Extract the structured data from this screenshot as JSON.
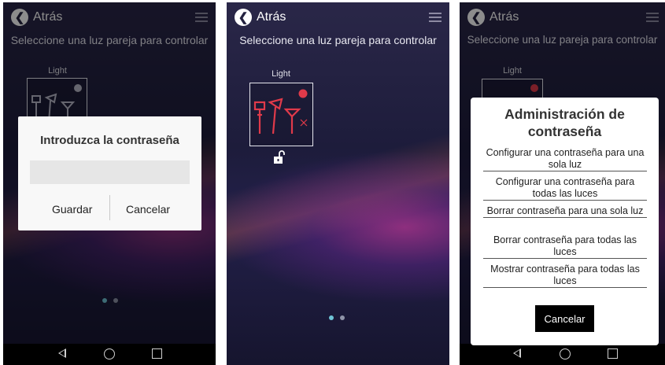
{
  "header": {
    "back_label": "Atrás",
    "subtitle": "Seleccione una luz pareja para controlar"
  },
  "device": {
    "label": "Light"
  },
  "password_dialog": {
    "title": "Introduzca la contraseña",
    "input_value": "",
    "save_label": "Guardar",
    "cancel_label": "Cancelar"
  },
  "password_admin_dialog": {
    "title": "Administración de contraseña",
    "options": [
      "Configurar una contraseña para una sola luz",
      "Configurar una contraseña para todas las luces",
      "Borrar contraseña para una sola luz",
      "Borrar contraseña para todas las luces",
      "Mostrar contraseña para todas las luces"
    ],
    "cancel_label": "Cancelar"
  },
  "pager": {
    "page_count": 2,
    "active_page": 1
  },
  "colors": {
    "accent_red": "#e03a4a",
    "dot_active": "#6fc4d6",
    "background_dark": "#1d1c3b"
  },
  "icons": [
    "back-arrow-icon",
    "menu-icon",
    "lights-icon",
    "unlocked-icon",
    "nav-back-icon",
    "nav-home-icon",
    "nav-recents-icon"
  ]
}
